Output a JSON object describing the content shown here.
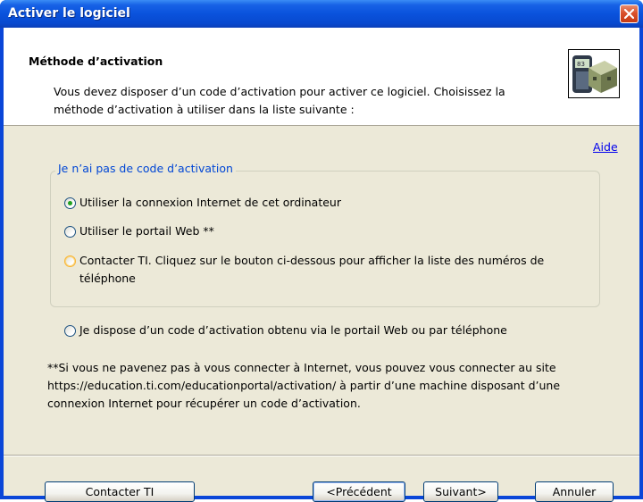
{
  "window": {
    "title": "Activer le logiciel"
  },
  "header": {
    "title": "Méthode d’activation",
    "description": "Vous devez disposer d’un code d’activation pour activer ce logiciel. Choisissez la méthode d’activation à utiliser dans la liste suivante :"
  },
  "help_link": "Aide",
  "group": {
    "legend": "Je n’ai pas de code d’activation",
    "options": [
      {
        "label": "Utiliser la connexion Internet de cet ordinateur",
        "selected": true
      },
      {
        "label": "Utiliser le portail Web **",
        "selected": false
      },
      {
        "label": "Contacter TI. Cliquez sur le bouton ci-dessous pour afficher la liste des numéros de téléphone",
        "selected": false
      }
    ]
  },
  "have_code_option": {
    "label": "Je dispose d’un code d’activation obtenu via le portail Web ou par téléphone",
    "selected": false
  },
  "footnote": "**Si vous ne pavenez pas à vous connecter à Internet, vous pouvez vous connecter au site https://education.ti.com/educationportal/activation/ à partir d’une machine disposant d’une connexion Internet pour récupérer un code d’activation.",
  "buttons": {
    "contact": "Contacter TI",
    "back": "<Précédent",
    "next": "Suivant>",
    "cancel": "Annuler"
  },
  "colors": {
    "titlebar": "#0a52dc",
    "client_bg": "#ece9d8",
    "legend_text": "#0046d5",
    "link": "#0000ee",
    "close_button": "#d9502c"
  },
  "icons": {
    "close": "close-icon",
    "header": "calculator-package-icon"
  }
}
